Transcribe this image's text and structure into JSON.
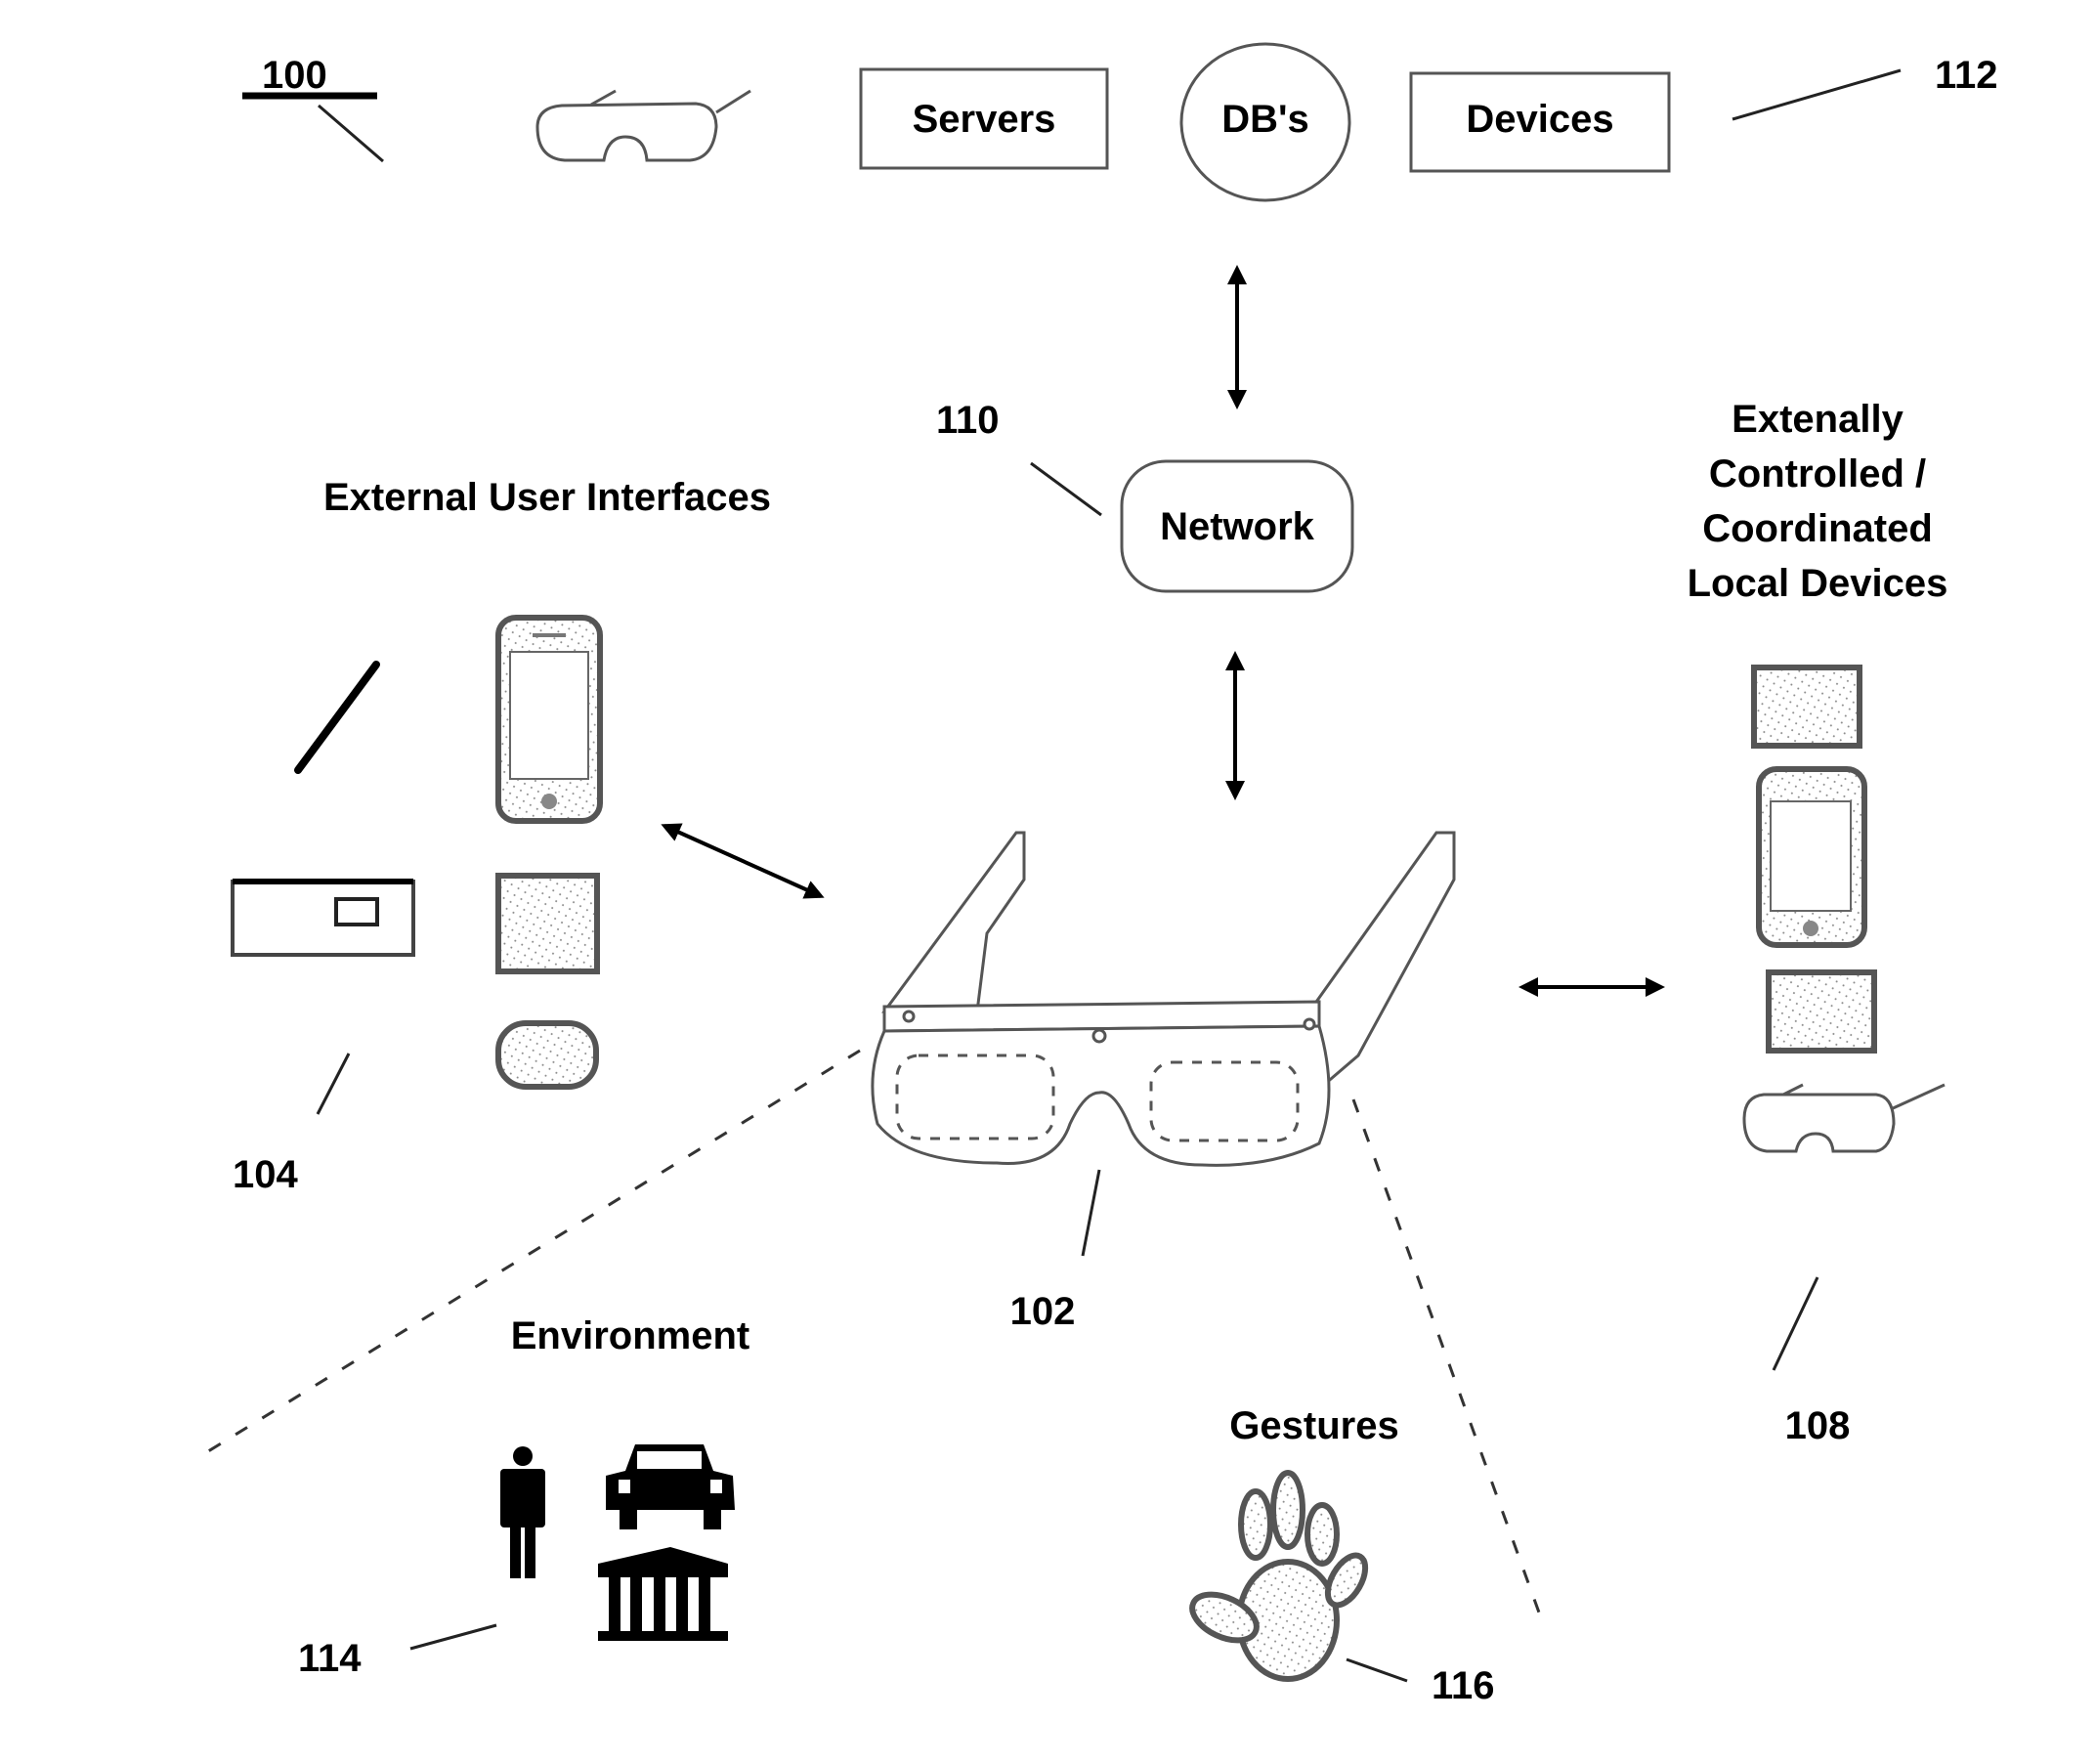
{
  "figure": {
    "reference_numeral": "100"
  },
  "top_row": {
    "servers_label": "Servers",
    "dbs_label": "DB's",
    "devices_label": "Devices",
    "group_ref": "112"
  },
  "network": {
    "label": "Network",
    "ref": "110"
  },
  "external_user_interfaces": {
    "title": "External User Interfaces",
    "ref": "104"
  },
  "local_devices": {
    "title_lines": [
      "Extenally",
      "Controlled /",
      "Coordinated",
      "Local Devices"
    ],
    "ref": "108"
  },
  "glasses": {
    "ref": "102"
  },
  "environment": {
    "title": "Environment",
    "ref": "114",
    "icons": [
      "person-icon",
      "car-icon",
      "building-icon"
    ]
  },
  "gestures": {
    "title": "Gestures",
    "ref": "116",
    "icon": "hand-icon"
  }
}
